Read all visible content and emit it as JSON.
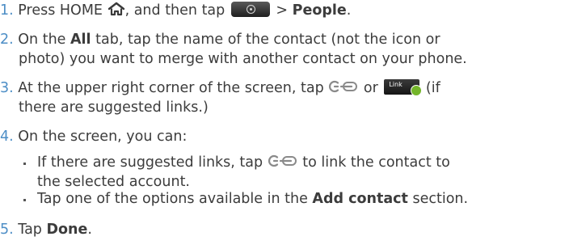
{
  "steps": [
    {
      "number": "1.",
      "a": "Press HOME",
      "b": ", and then tap",
      "c": ">",
      "people": "People",
      "end": "."
    },
    {
      "number": "2.",
      "a": "On the",
      "all": "All",
      "b": "tab, tap the name of the contact (not the icon or",
      "line2": "photo) you want to merge with another contact on your phone."
    },
    {
      "number": "3.",
      "a": "At the upper right corner of the screen, tap",
      "or": "or",
      "b": "(if",
      "line2": "there are suggested links.)"
    },
    {
      "number": "4.",
      "text": "On the screen, you can:",
      "bullets": [
        {
          "a": "If there are suggested links, tap",
          "b": "to link the contact to",
          "line2": "the selected account."
        },
        {
          "a": "Tap one of the options available in the",
          "add_contact": "Add contact",
          "b": "section."
        }
      ]
    },
    {
      "number": "5.",
      "a": "Tap",
      "done": "Done",
      "end": "."
    }
  ],
  "icons": {
    "home": "home-icon",
    "app": "all-apps-button-icon",
    "link": "link-contacts-icon",
    "suggested": "suggested-links-button-icon"
  },
  "link_button_text": "Link",
  "colors": {
    "step_number": "#4d8ec6",
    "body_text": "#3c3c3c",
    "icon_gray": "#8a8a8a",
    "badge_green": "#74b52a"
  }
}
